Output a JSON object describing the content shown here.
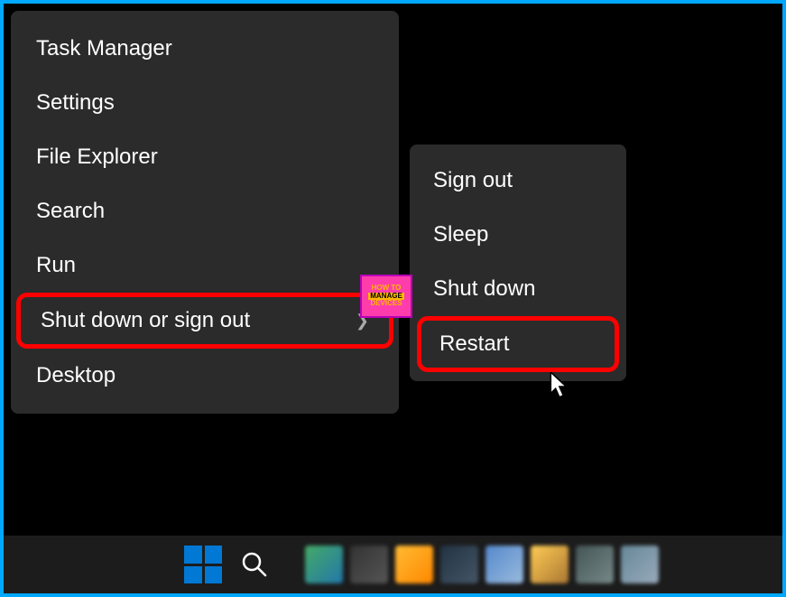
{
  "main_menu": {
    "items": [
      {
        "label": "Task Manager",
        "has_submenu": false
      },
      {
        "label": "Settings",
        "has_submenu": false
      },
      {
        "label": "File Explorer",
        "has_submenu": false
      },
      {
        "label": "Search",
        "has_submenu": false
      },
      {
        "label": "Run",
        "has_submenu": false
      },
      {
        "label": "Shut down or sign out",
        "has_submenu": true,
        "highlighted": true
      },
      {
        "label": "Desktop",
        "has_submenu": false
      }
    ]
  },
  "submenu": {
    "items": [
      {
        "label": "Sign out"
      },
      {
        "label": "Sleep"
      },
      {
        "label": "Shut down"
      },
      {
        "label": "Restart",
        "highlighted": true,
        "cursor_on": true
      }
    ]
  },
  "watermark": {
    "line1": "HOW TO",
    "line2": "MANAGE",
    "line3": "DEVICES"
  },
  "annotations": {
    "highlight_color": "#ff0000"
  }
}
